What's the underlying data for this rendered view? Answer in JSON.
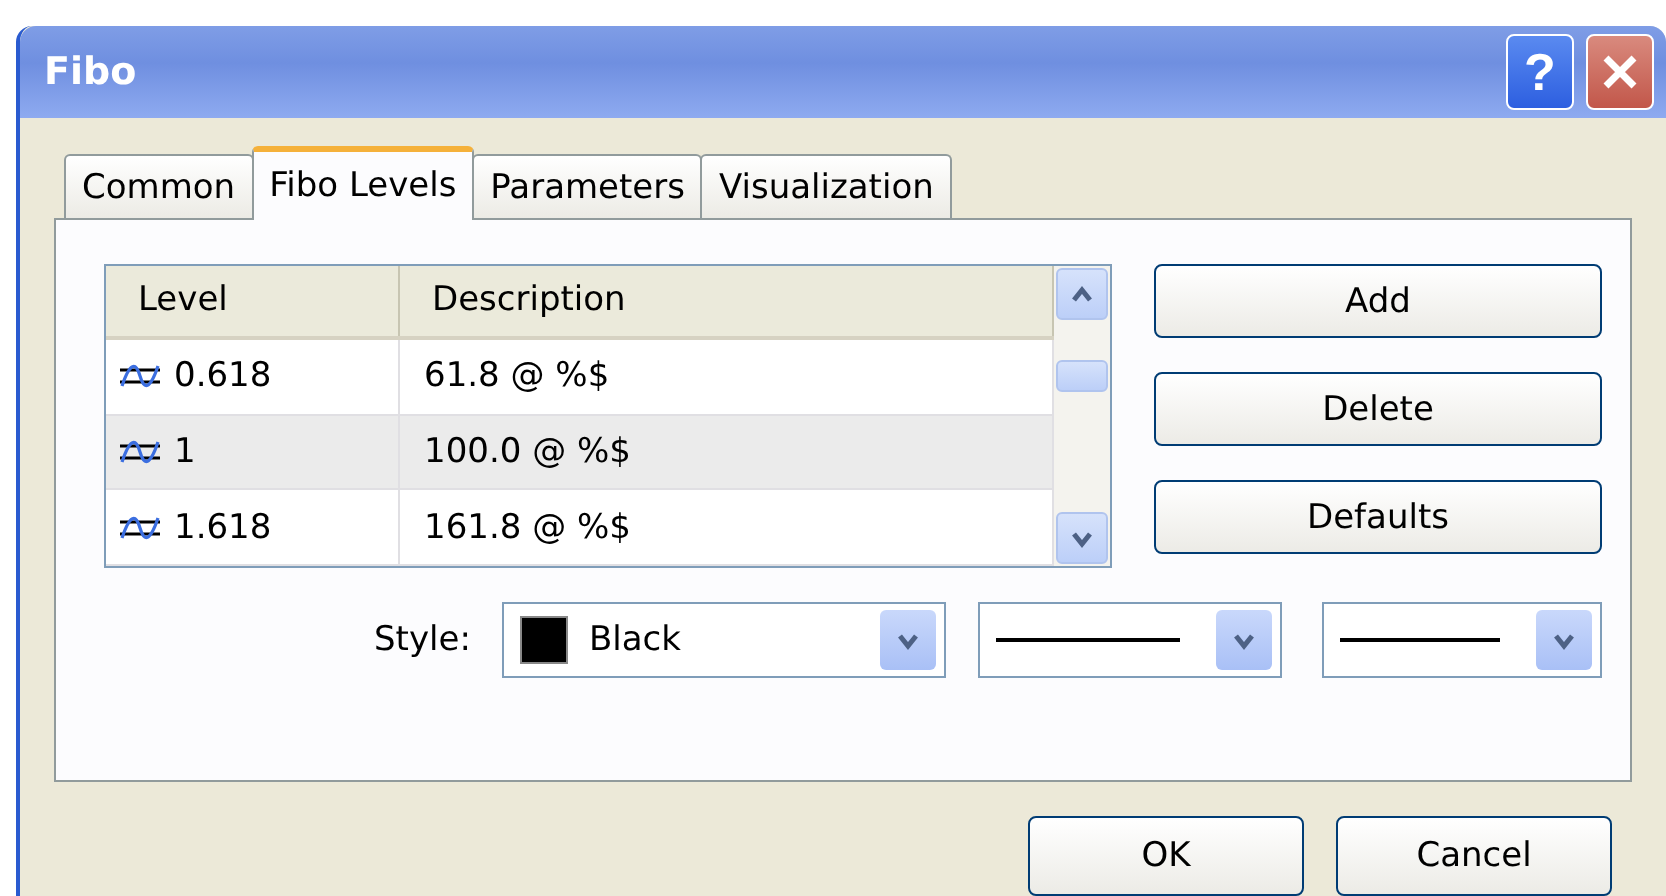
{
  "window": {
    "title": "Fibo",
    "help_label": "?"
  },
  "tabs": [
    {
      "label": "Common",
      "selected": false
    },
    {
      "label": "Fibo Levels",
      "selected": true
    },
    {
      "label": "Parameters",
      "selected": false
    },
    {
      "label": "Visualization",
      "selected": false
    }
  ],
  "levels_table": {
    "columns": [
      "Level",
      "Description"
    ],
    "rows": [
      {
        "level": "0.618",
        "description": "61.8 @ %$",
        "selected": false
      },
      {
        "level": "1",
        "description": "100.0 @ %$",
        "selected": true
      },
      {
        "level": "1.618",
        "description": "161.8 @ %$",
        "selected": false
      }
    ]
  },
  "buttons": [
    "Add",
    "Delete",
    "Defaults"
  ],
  "style": {
    "label": "Style:",
    "color_combo": {
      "value": "Black",
      "color": "#000000"
    }
  },
  "dialog_buttons": [
    "OK",
    "Cancel"
  ]
}
